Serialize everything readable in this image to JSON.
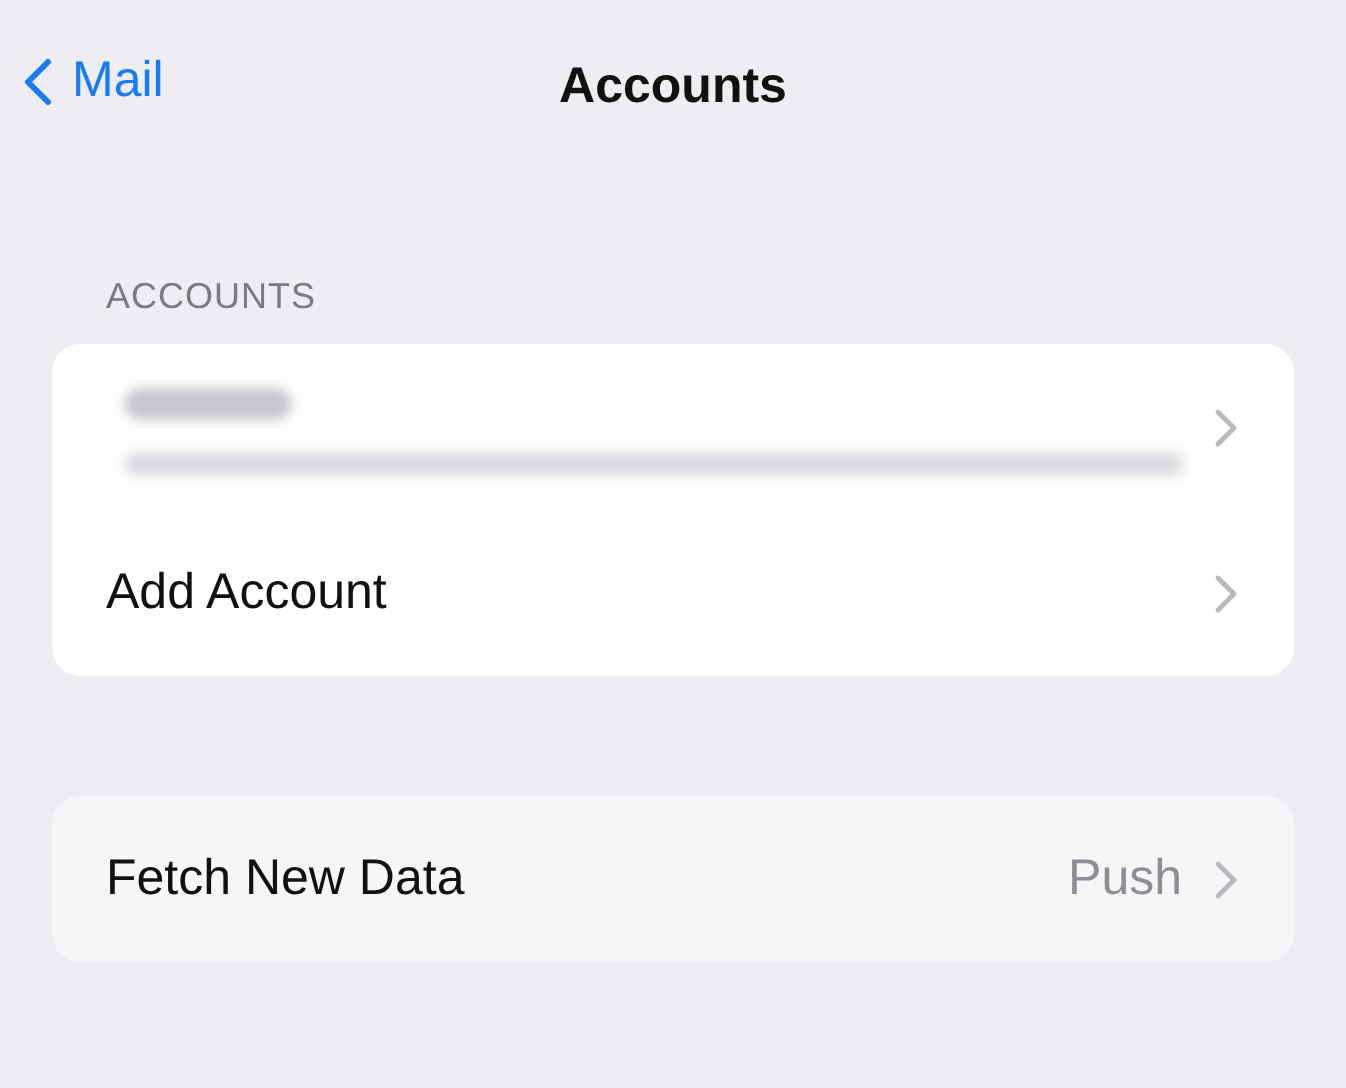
{
  "nav": {
    "back": "Mail",
    "title": "Accounts"
  },
  "accounts": {
    "header": "ACCOUNTS",
    "items": [
      {
        "kind": "redacted"
      },
      {
        "kind": "label",
        "label": "Add Account"
      }
    ]
  },
  "fetch": {
    "label": "Fetch New Data",
    "value": "Push"
  }
}
